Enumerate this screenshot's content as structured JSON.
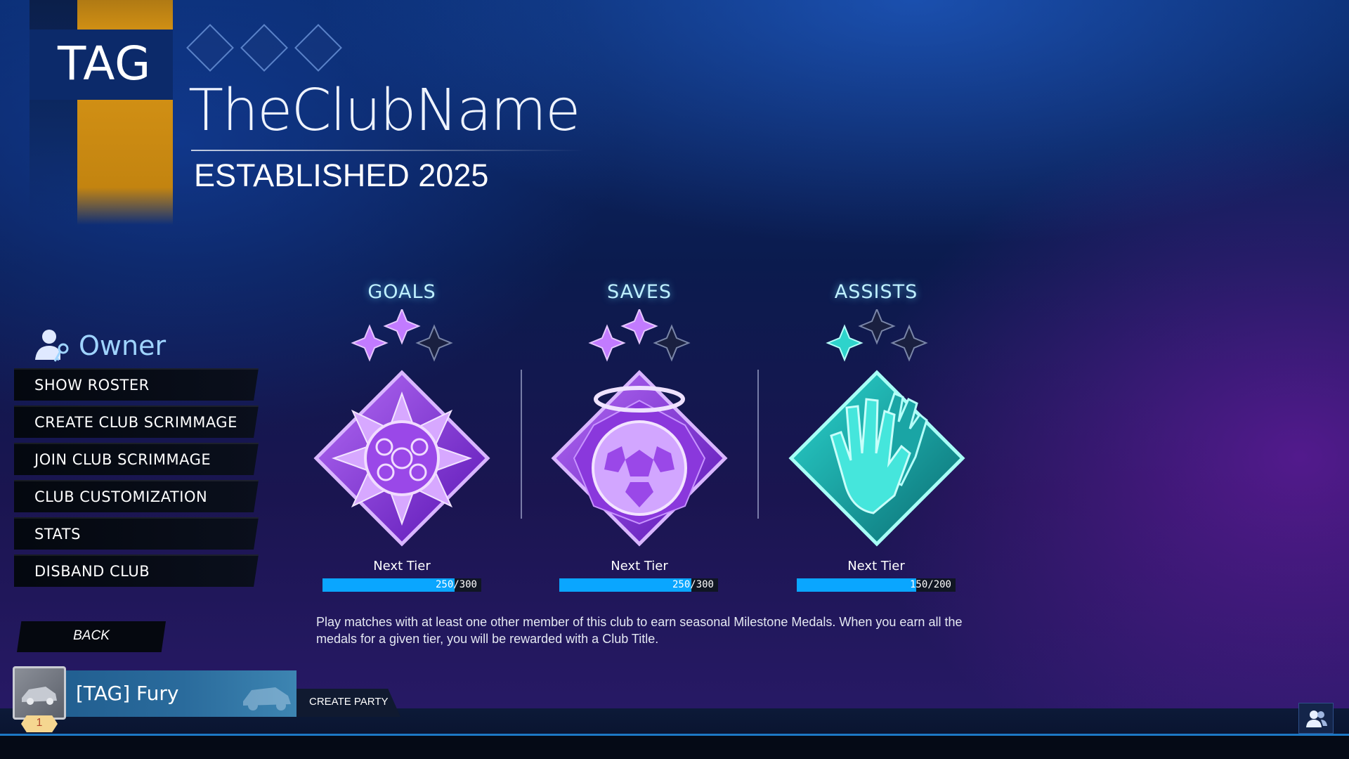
{
  "club": {
    "tag": "TAG",
    "name": "TheClubName",
    "established": "ESTABLISHED 2025",
    "banner_colors": {
      "primary": "#0c2a6a",
      "accent": "#d08f14"
    }
  },
  "role": {
    "label": "Owner",
    "icon": "owner-keys-icon"
  },
  "menu": {
    "items": [
      {
        "label": "SHOW ROSTER"
      },
      {
        "label": "CREATE CLUB SCRIMMAGE"
      },
      {
        "label": "JOIN CLUB SCRIMMAGE"
      },
      {
        "label": "CLUB CUSTOMIZATION"
      },
      {
        "label": "STATS"
      },
      {
        "label": "DISBAND CLUB"
      }
    ],
    "back_label": "BACK"
  },
  "milestones": [
    {
      "title": "GOALS",
      "icon": "goal-ball-burst-icon",
      "next_tier_label": "Next Tier",
      "progress_text": "250/300",
      "progress": 0.8333,
      "stars_earned": 2,
      "color": "#8a3fe0"
    },
    {
      "title": "SAVES",
      "icon": "halo-ball-icon",
      "next_tier_label": "Next Tier",
      "progress_text": "250/300",
      "progress": 0.8333,
      "stars_earned": 2,
      "color": "#8a3fe0"
    },
    {
      "title": "ASSISTS",
      "icon": "high-five-hands-icon",
      "next_tier_label": "Next Tier",
      "progress_text": "150/200",
      "progress": 0.75,
      "stars_earned": 1,
      "color": "#16b3b3"
    }
  ],
  "description": "Play matches with at least one other member of this club to earn seasonal Milestone Medals. When you earn all the medals for a given tier, you will be rewarded with a Club Title.",
  "player": {
    "name": "[TAG] Fury",
    "level": "1",
    "avatar_icon": "car-avatar-icon"
  },
  "bottom": {
    "create_party_label": "CREATE PARTY",
    "friends_icon": "friends-icon"
  }
}
